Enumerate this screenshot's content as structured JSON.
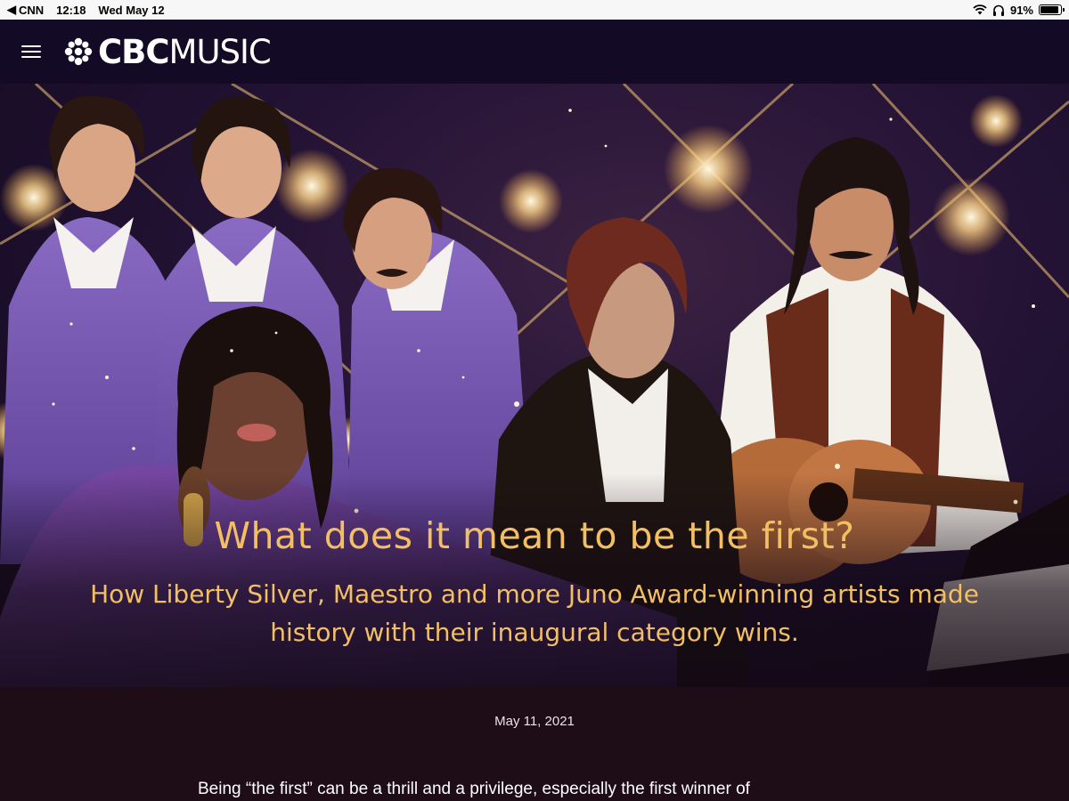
{
  "status_bar": {
    "back_app": "CNN",
    "time": "12:18",
    "date": "Wed May 12",
    "battery": "91%",
    "battery_level": 0.91,
    "icons": [
      "back-chevron-icon",
      "wifi-icon",
      "headphones-icon",
      "battery-icon"
    ]
  },
  "header": {
    "menu_icon": "hamburger-menu-icon",
    "logo_icon": "cbc-gem-icon",
    "logo_bold": "CBC",
    "logo_light": "MUSIC",
    "background": "#130a26"
  },
  "hero": {
    "title": "What does it mean to be the first?",
    "subtitle": "How Liberty Silver, Maestro and more Juno Award-winning artists made history with their inaugural category wins.",
    "accent_color": "#f2bf63"
  },
  "article": {
    "date": "May 11, 2021",
    "intro": "Being “the first” can be a thrill and a privilege, especially the first winner of",
    "background": "#1e0c16"
  }
}
